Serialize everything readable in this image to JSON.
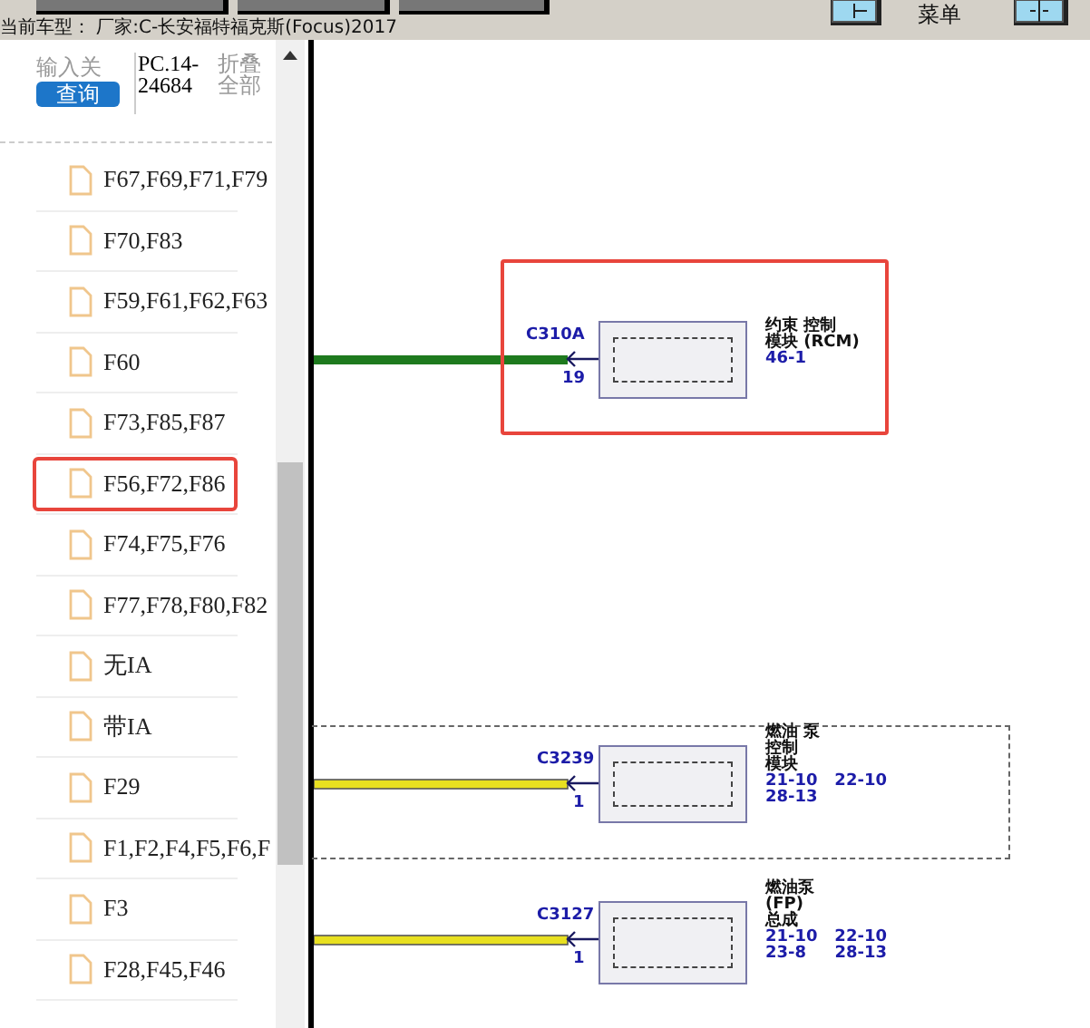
{
  "toolbar": {
    "menu_label": "菜单",
    "vehicle": "当前车型： 厂家:C-长安福特福克斯(Focus)2017"
  },
  "sidebar": {
    "search": {
      "placeholder": "输入关"
    },
    "search_button": "查询",
    "code": "PC.14-24684",
    "collapse": "折叠全部",
    "items": [
      {
        "label": "F67,F69,F71,F79",
        "selected": false
      },
      {
        "label": "F70,F83",
        "selected": false
      },
      {
        "label": "F59,F61,F62,F63",
        "selected": false
      },
      {
        "label": "F60",
        "selected": false
      },
      {
        "label": "F73,F85,F87",
        "selected": false
      },
      {
        "label": "F56,F72,F86",
        "selected": true
      },
      {
        "label": "F74,F75,F76",
        "selected": false
      },
      {
        "label": "F77,F78,F80,F82",
        "selected": false
      },
      {
        "label": "无IA",
        "selected": false
      },
      {
        "label": "带IA",
        "selected": false
      },
      {
        "label": "F29",
        "selected": false
      },
      {
        "label": "F1,F2,F4,F5,F6,F",
        "selected": false
      },
      {
        "label": "F3",
        "selected": false
      },
      {
        "label": "F28,F45,F46",
        "selected": false
      }
    ]
  },
  "diagram": {
    "modules": [
      {
        "connector": "C310A",
        "pin": "19",
        "name_lines": [
          "约束 控制",
          "模块 (RCM)"
        ],
        "refs": [
          "46-1"
        ],
        "color": "#1e7a1e",
        "highlighted": true,
        "grouped": false
      },
      {
        "connector": "C3239",
        "pin": "1",
        "name_lines": [
          "燃油 泵",
          "控制",
          "模块"
        ],
        "refs": [
          "21-10   22-10",
          "28-13"
        ],
        "color": "#e8e020",
        "highlighted": false,
        "grouped": true
      },
      {
        "connector": "C3127",
        "pin": "1",
        "name_lines": [
          "燃油泵",
          "(FP)",
          "总成"
        ],
        "refs": [
          "21-10   22-10",
          "23-8     28-13"
        ],
        "color": "#e8e020",
        "highlighted": false,
        "grouped": false
      }
    ]
  }
}
